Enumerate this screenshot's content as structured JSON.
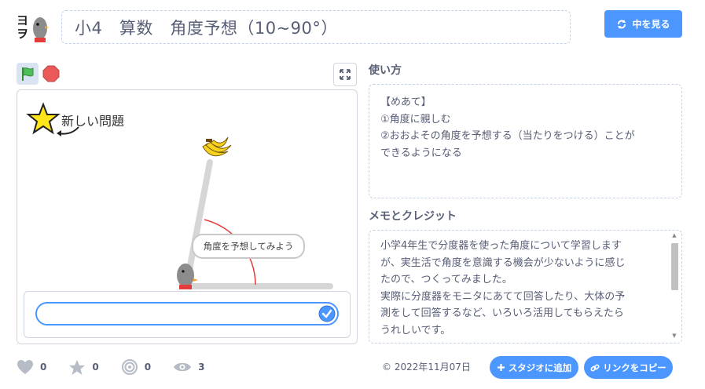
{
  "header": {
    "title": "小4　算数　角度予想（10~90°）",
    "see_inside_label": "中を見る",
    "accent": "#4c97ff"
  },
  "player": {
    "flag_icon": "green-flag-icon",
    "stop_icon": "stop-icon",
    "fullscreen_icon": "fullscreen-icon",
    "stage": {
      "new_problem_label": "新しい問題",
      "speech_bubble": "角度を予想してみよう",
      "answer_value": ""
    }
  },
  "stats": {
    "loves": "0",
    "favorites": "0",
    "remixes": "0",
    "views": "3"
  },
  "instructions": {
    "heading": "使い方",
    "lines": [
      "【めあて】",
      "①角度に親しむ",
      "②おおよその角度を予想する（当たりをつける）ことが",
      "できるようになる"
    ]
  },
  "notes": {
    "heading": "メモとクレジット",
    "lines": [
      "小学4年生で分度器を使った角度について学習します",
      "が、実生活で角度を意識する機会が少ないように感じ",
      "たので、つくってみました。",
      "実際に分度器をモニタにあてて回答したり、大体の予",
      "測をして回答するなど、いろいろ活用してもらえたら",
      "うれしいです。"
    ]
  },
  "footer": {
    "share_date": "© 2022年11月07日",
    "add_to_studio_label": "スタジオに追加",
    "copy_link_label": "リンクをコピー"
  }
}
